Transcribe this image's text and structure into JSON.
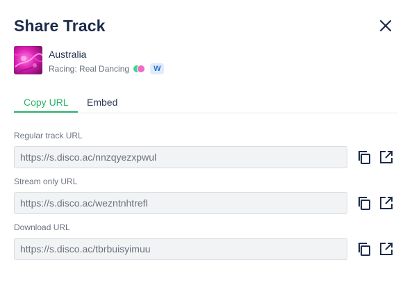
{
  "modal": {
    "title": "Share Track",
    "close_icon": "close-icon"
  },
  "track": {
    "title": "Australia",
    "subtitle": "Racing: Real Dancing",
    "badge": "W",
    "dot_colors": [
      "#39d98a",
      "#f06bc8"
    ]
  },
  "tabs": [
    {
      "label": "Copy URL",
      "active": true
    },
    {
      "label": "Embed",
      "active": false
    }
  ],
  "fields": [
    {
      "label": "Regular track URL",
      "value": "https://s.disco.ac/nnzqyezxpwul"
    },
    {
      "label": "Stream only URL",
      "value": "https://s.disco.ac/wezntnhtrefl"
    },
    {
      "label": "Download URL",
      "value": "https://s.disco.ac/tbrbuisyimuu"
    }
  ],
  "icons": {
    "copy": "copy-icon",
    "open": "external-link-icon"
  },
  "colors": {
    "accent": "#2bb26b",
    "badge_bg": "#e1ecfb",
    "badge_text": "#2f6fd6",
    "title": "#1c2b4a"
  }
}
